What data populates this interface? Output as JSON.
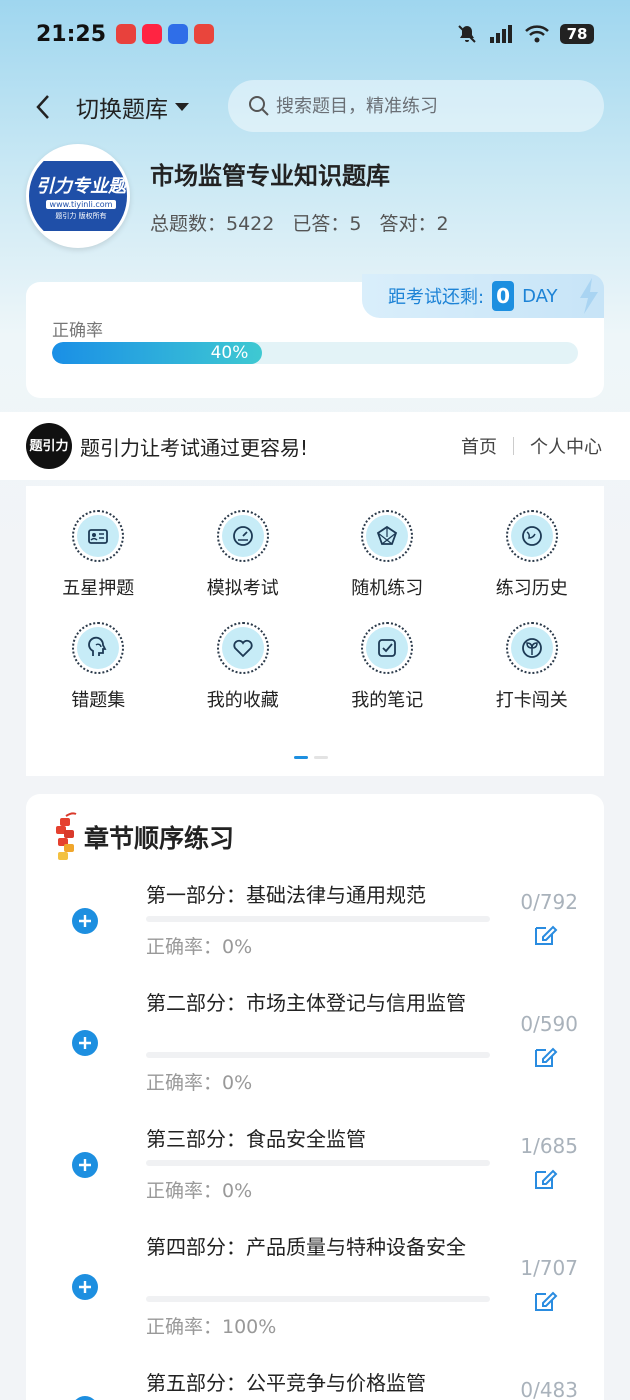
{
  "status_bar": {
    "time": "21:25",
    "battery": "78",
    "network": "5G"
  },
  "top_nav": {
    "switch_label": "切换题库",
    "search_placeholder": "搜索题目，精准练习"
  },
  "bank": {
    "logo_text": "引力专业题",
    "logo_url": "www.tiyinli.com",
    "logo_sub": "题引力 版权所有",
    "title": "市场监管专业知识题库",
    "total": "总题数：5422",
    "answered": "已答：5",
    "correct": "答对：2"
  },
  "exam": {
    "countdown_label": "距考试还剩:",
    "days": "0",
    "unit": "DAY"
  },
  "accuracy": {
    "label": "正确率",
    "percent_text": "40%",
    "fraction": 0.4
  },
  "slogan": {
    "logo_text": "题引力",
    "text": "题引力让考试通过更容易!",
    "home": "首页",
    "profile": "个人中心"
  },
  "tools": [
    {
      "label": "五星押题",
      "icon": "id-card-icon"
    },
    {
      "label": "模拟考试",
      "icon": "gauge-icon"
    },
    {
      "label": "随机练习",
      "icon": "random-icon"
    },
    {
      "label": "练习历史",
      "icon": "history-icon"
    },
    {
      "label": "错题集",
      "icon": "head-icon"
    },
    {
      "label": "我的收藏",
      "icon": "heart-icon"
    },
    {
      "label": "我的笔记",
      "icon": "note-icon"
    },
    {
      "label": "打卡闯关",
      "icon": "sprout-icon"
    }
  ],
  "chapters_title": "章节顺序练习",
  "chapters": [
    {
      "name": "第一部分：基础法律与通用规范",
      "acc": "正确率：0%",
      "count": "0/792"
    },
    {
      "name": "第二部分：市场主体登记与信用监管",
      "acc": "正确率：0%",
      "count": "0/590"
    },
    {
      "name": "第三部分：食品安全监管",
      "acc": "正确率：0%",
      "count": "1/685"
    },
    {
      "name": "第四部分：产品质量与特种设备安全",
      "acc": "正确率：100%",
      "count": "1/707"
    },
    {
      "name": "第五部分：公平竞争与价格监管",
      "acc": "",
      "count": "0/483"
    }
  ],
  "colors": {
    "accent": "#1d8fe0",
    "icon_bg": "#c7ecf7"
  }
}
